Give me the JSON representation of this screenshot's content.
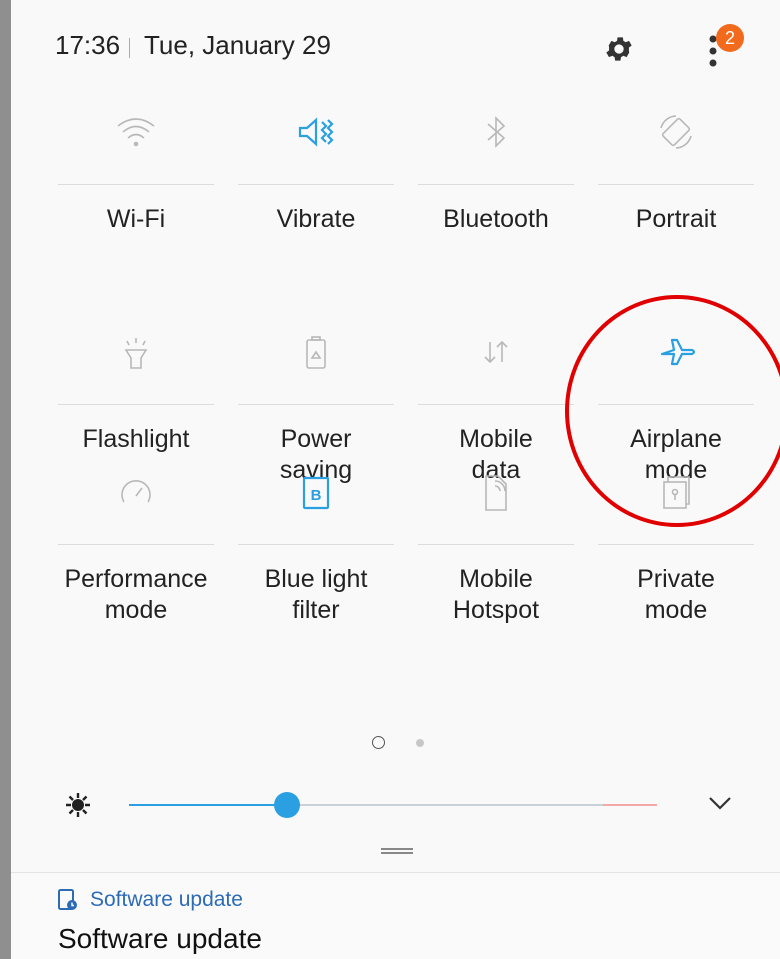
{
  "status": {
    "time": "17:36",
    "date": "Tue, January 29",
    "badge_count": "2"
  },
  "tiles": [
    {
      "label": "Wi-Fi",
      "icon": "wifi-icon",
      "active": false
    },
    {
      "label": "Vibrate",
      "icon": "vibrate-icon",
      "active": true
    },
    {
      "label": "Bluetooth",
      "icon": "bluetooth-icon",
      "active": false
    },
    {
      "label": "Portrait",
      "icon": "rotation-icon",
      "active": false
    },
    {
      "label": "Flashlight",
      "icon": "flashlight-icon",
      "active": false
    },
    {
      "label": "Power\nsaving",
      "icon": "power-saving-icon",
      "active": false
    },
    {
      "label": "Mobile\ndata",
      "icon": "mobile-data-icon",
      "active": false
    },
    {
      "label": "Airplane\nmode",
      "icon": "airplane-icon",
      "active": true
    },
    {
      "label": "Performance\nmode",
      "icon": "performance-icon",
      "active": false
    },
    {
      "label": "Blue light\nfilter",
      "icon": "blue-light-icon",
      "active": true
    },
    {
      "label": "Mobile\nHotspot",
      "icon": "hotspot-icon",
      "active": false
    },
    {
      "label": "Private\nmode",
      "icon": "private-mode-icon",
      "active": false
    }
  ],
  "pager": {
    "pages": 2,
    "current": 1
  },
  "brightness": {
    "level": 0.3
  },
  "notification": {
    "app_name": "Software update",
    "title": "Software update"
  },
  "colors": {
    "accent": "#2aa0e2",
    "inactive": "#9a9a9a",
    "highlight_circle": "#e00000",
    "badge": "#f26a1b"
  }
}
